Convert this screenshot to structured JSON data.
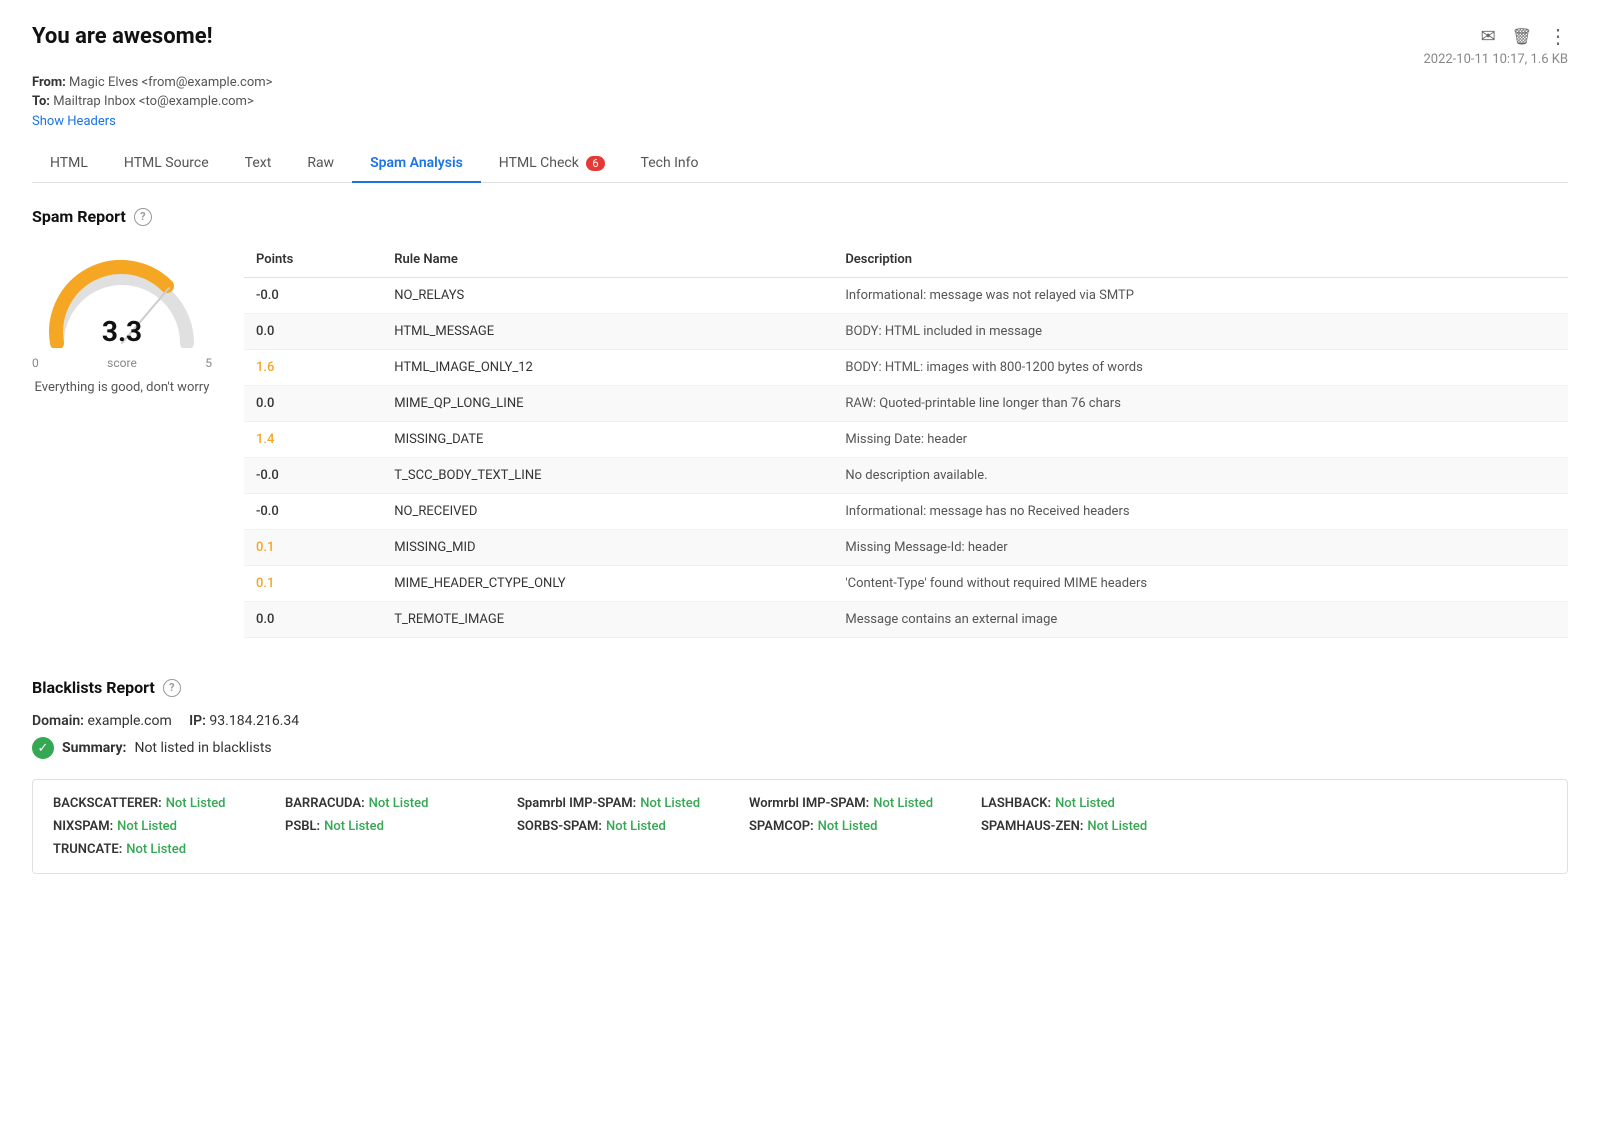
{
  "header": {
    "title": "You are awesome!",
    "from_label": "From:",
    "from_value": "Magic Elves <from@example.com>",
    "to_label": "To:",
    "to_value": "Mailtrap Inbox <to@example.com>",
    "show_headers": "Show Headers",
    "date_size": "2022-10-11 10:17, 1.6 KB",
    "icons": {
      "email": "✉",
      "delete": "🗑",
      "more": "⋮"
    }
  },
  "tabs": [
    {
      "id": "html",
      "label": "HTML",
      "active": false
    },
    {
      "id": "html-source",
      "label": "HTML Source",
      "active": false
    },
    {
      "id": "text",
      "label": "Text",
      "active": false
    },
    {
      "id": "raw",
      "label": "Raw",
      "active": false
    },
    {
      "id": "spam-analysis",
      "label": "Spam Analysis",
      "active": true
    },
    {
      "id": "html-check",
      "label": "HTML Check",
      "active": false,
      "badge": "6"
    },
    {
      "id": "tech-info",
      "label": "Tech Info",
      "active": false
    }
  ],
  "spam_report": {
    "section_title": "Spam Report",
    "score": "3.3",
    "score_min": "0",
    "score_label": "score",
    "score_max": "5",
    "gauge_message": "Everything is good, don't worry",
    "table": {
      "col_points": "Points",
      "col_rule": "Rule Name",
      "col_desc": "Description",
      "rows": [
        {
          "points": "-0.0",
          "highlight": false,
          "rule": "NO_RELAYS",
          "desc": "Informational: message was not relayed via SMTP"
        },
        {
          "points": "0.0",
          "highlight": false,
          "rule": "HTML_MESSAGE",
          "desc": "BODY: HTML included in message"
        },
        {
          "points": "1.6",
          "highlight": true,
          "rule": "HTML_IMAGE_ONLY_12",
          "desc": "BODY: HTML: images with 800-1200 bytes of words"
        },
        {
          "points": "0.0",
          "highlight": false,
          "rule": "MIME_QP_LONG_LINE",
          "desc": "RAW: Quoted-printable line longer than 76 chars"
        },
        {
          "points": "1.4",
          "highlight": true,
          "rule": "MISSING_DATE",
          "desc": "Missing Date: header"
        },
        {
          "points": "-0.0",
          "highlight": false,
          "rule": "T_SCC_BODY_TEXT_LINE",
          "desc": "No description available."
        },
        {
          "points": "-0.0",
          "highlight": false,
          "rule": "NO_RECEIVED",
          "desc": "Informational: message has no Received headers"
        },
        {
          "points": "0.1",
          "highlight": true,
          "rule": "MISSING_MID",
          "desc": "Missing Message-Id: header"
        },
        {
          "points": "0.1",
          "highlight": true,
          "rule": "MIME_HEADER_CTYPE_ONLY",
          "desc": "'Content-Type' found without required MIME headers"
        },
        {
          "points": "0.0",
          "highlight": false,
          "rule": "T_REMOTE_IMAGE",
          "desc": "Message contains an external image"
        }
      ]
    }
  },
  "blacklists_report": {
    "section_title": "Blacklists Report",
    "domain_label": "Domain:",
    "domain_value": "example.com",
    "ip_label": "IP:",
    "ip_value": "93.184.216.34",
    "summary_label": "Summary:",
    "summary_value": "Not listed in blacklists",
    "not_listed_text": "Not Listed",
    "items": [
      {
        "name": "BACKSCATTERER:",
        "status": "Not Listed"
      },
      {
        "name": "BARRACUDA:",
        "status": "Not Listed"
      },
      {
        "name": "Spamrbl IMP-SPAM:",
        "status": "Not Listed"
      },
      {
        "name": "Wormrbl IMP-SPAM:",
        "status": "Not Listed"
      },
      {
        "name": "LASHBACK:",
        "status": "Not Listed"
      },
      {
        "name": "NIXSPAM:",
        "status": "Not Listed"
      },
      {
        "name": "PSBL:",
        "status": "Not Listed"
      },
      {
        "name": "SORBS-SPAM:",
        "status": "Not Listed"
      },
      {
        "name": "SPAMCOP:",
        "status": "Not Listed"
      },
      {
        "name": "SPAMHAUS-ZEN:",
        "status": "Not Listed"
      },
      {
        "name": "TRUNCATE:",
        "status": "Not Listed"
      }
    ]
  }
}
